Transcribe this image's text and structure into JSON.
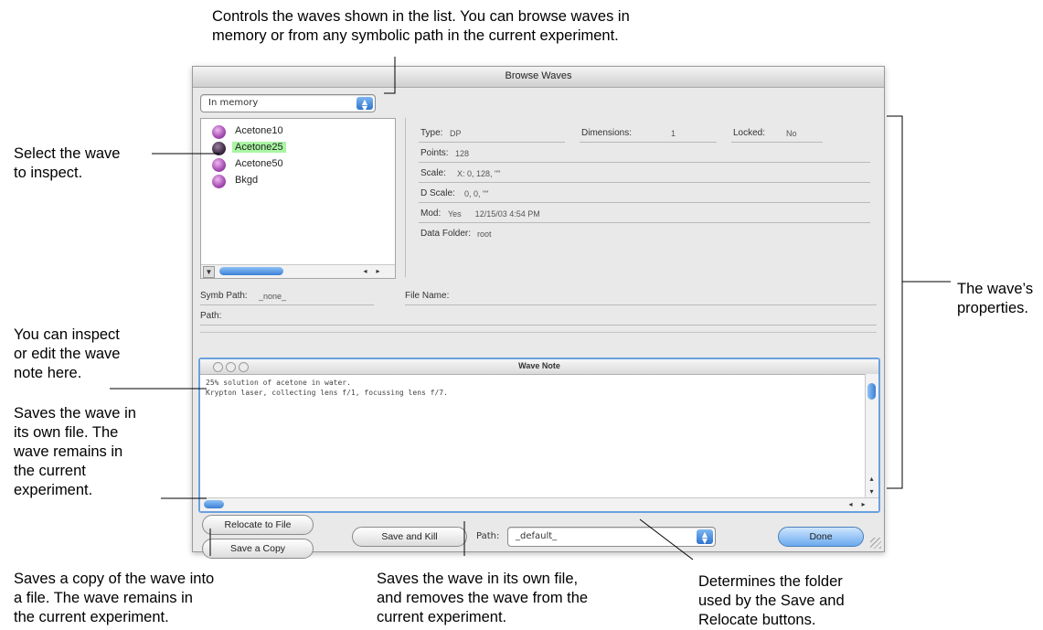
{
  "callouts": {
    "top": [
      "Controls the waves shown in the list. You can browse waves in",
      "memory or from any symbolic path in the current experiment."
    ],
    "select": [
      "Select the wave",
      "to inspect."
    ],
    "properties": [
      "The wave’s",
      "properties."
    ],
    "inspect": [
      "You can inspect",
      "or edit the wave",
      "note here."
    ],
    "relocate": [
      "Saves the wave in",
      "its own file. The",
      "wave remains in",
      "the current",
      "experiment."
    ],
    "copy": [
      "Saves a copy of the wave into",
      "a file. The wave remains in",
      "the current experiment."
    ],
    "kill": [
      "Saves the wave in its own file,",
      "and removes the wave from the",
      "current experiment."
    ],
    "folder": [
      "Determines the folder",
      "used by the Save and",
      "Relocate buttons."
    ]
  },
  "dialog": {
    "title": "Browse Waves",
    "source_select": "In memory",
    "waves": [
      {
        "name": "Acetone10",
        "selected": false
      },
      {
        "name": "Acetone25",
        "selected": true
      },
      {
        "name": "Acetone50",
        "selected": false
      },
      {
        "name": "Bkgd",
        "selected": false
      }
    ],
    "props": {
      "type_label": "Type:",
      "type_value": "DP",
      "dims_label": "Dimensions:",
      "dims_value": "1",
      "locked_label": "Locked:",
      "locked_value": "No",
      "points_label": "Points:",
      "points_value": "128",
      "scale_label": "Scale:",
      "scale_value": "X: 0, 128, \"\"",
      "dscale_label": "D Scale:",
      "dscale_value": "0, 0, \"\"",
      "mod_label": "Mod:",
      "mod_value": "Yes      12/15/03 4:54 PM",
      "folder_label": "Data Folder:",
      "folder_value": "root"
    },
    "symb_path_label": "Symb Path:",
    "symb_path_value": "_none_",
    "file_name_label": "File Name:",
    "path_label": "Path:",
    "note": {
      "title": "Wave Note",
      "lines": [
        "25% solution of acetone in water.",
        "Krypton laser, collecting lens f/1, focussing lens f/7."
      ]
    },
    "buttons": {
      "relocate": "Relocate to File",
      "copy": "Save a Copy",
      "kill": "Save and Kill",
      "done": "Done"
    },
    "save_path_label": "Path:",
    "save_path_value": "_default_"
  }
}
